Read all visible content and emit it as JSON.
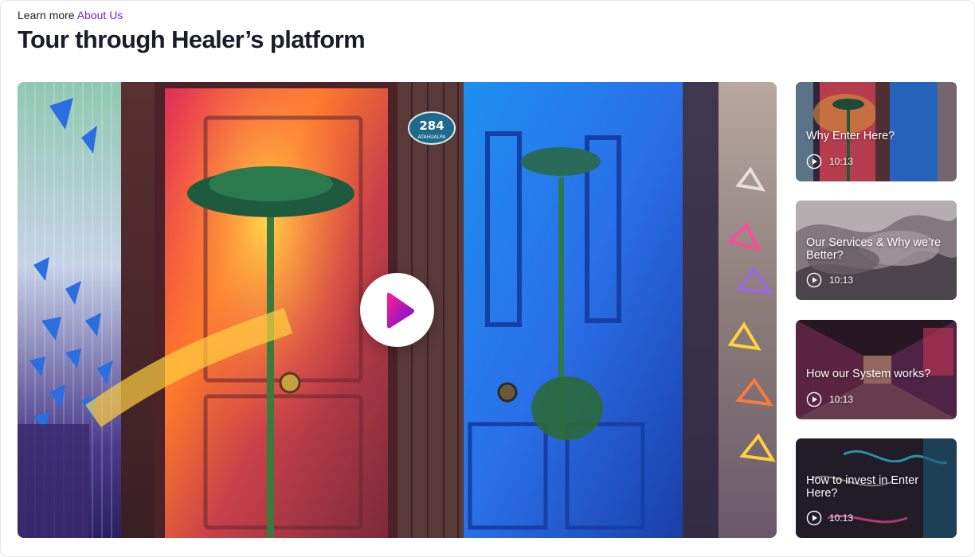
{
  "header": {
    "eyebrow_prefix": "Learn more",
    "eyebrow_link": "About Us",
    "title": "Tour through Healer’s platform"
  },
  "main_video": {
    "door_number": "284",
    "door_street": "ATAHUALPA"
  },
  "playlist": [
    {
      "title": "Why Enter Here?",
      "duration": "10:13"
    },
    {
      "title": "Our Services & Why we’re Better?",
      "duration": "10:13"
    },
    {
      "title": "How our System works?",
      "duration": "10:13"
    },
    {
      "title": "How to invest in Enter Here?",
      "duration": "10:13"
    }
  ],
  "colors": {
    "accent": "#7a1fd6",
    "play_gradient_start": "#ff1f8a",
    "play_gradient_end": "#6a12e0"
  },
  "icons": {
    "main_play": "play-icon",
    "thumb_play": "play-circle-icon"
  }
}
